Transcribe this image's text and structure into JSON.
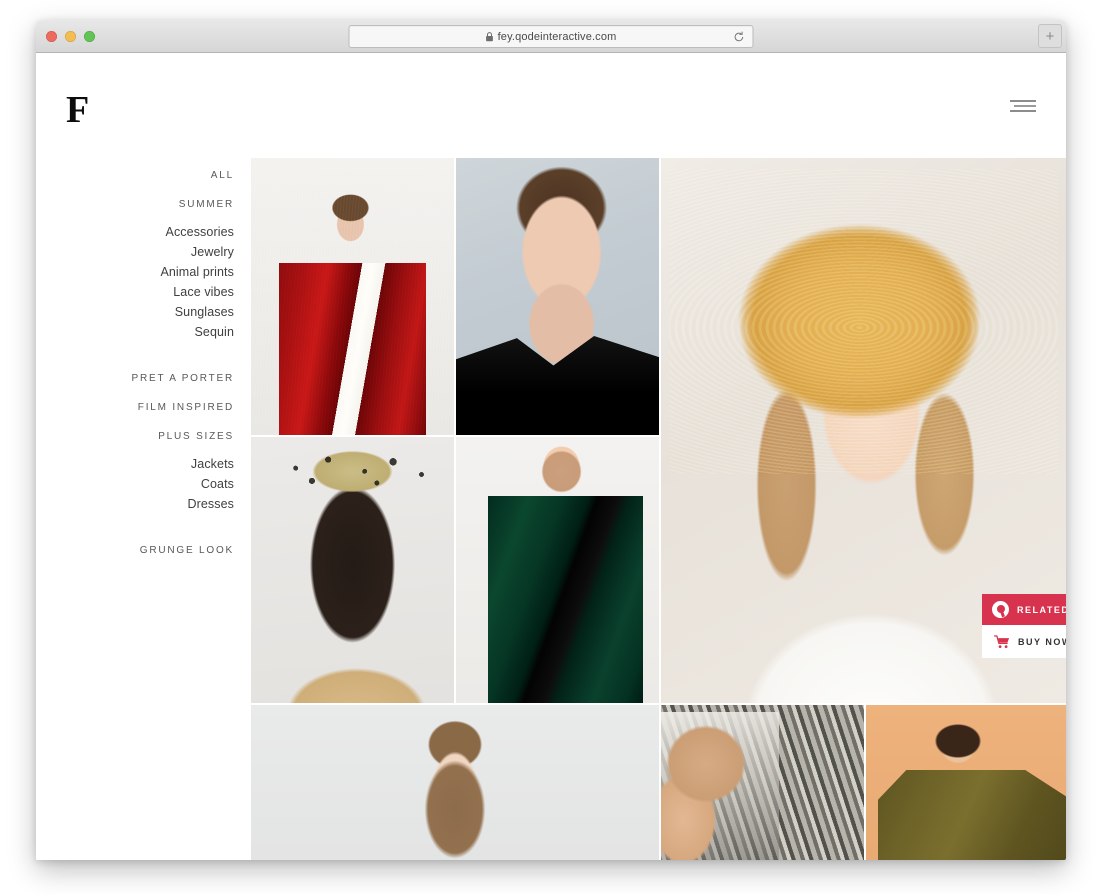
{
  "browser": {
    "url": "fey.qodeinteractive.com",
    "lock_icon": "lock-icon",
    "reload_icon": "reload-icon",
    "new_tab_label": "+",
    "traffic_lights": [
      {
        "name": "close",
        "color": "#ee6a5f"
      },
      {
        "name": "minimize",
        "color": "#f5bd4f"
      },
      {
        "name": "zoom",
        "color": "#61c454"
      }
    ]
  },
  "site": {
    "logo": "F",
    "menu_icon": "hamburger-menu-icon"
  },
  "sidebar": {
    "items": [
      {
        "label": "ALL",
        "type": "cat",
        "active": true
      },
      {
        "label": "SUMMER",
        "type": "cat"
      },
      {
        "label": "Accessories",
        "type": "sub"
      },
      {
        "label": "Jewelry",
        "type": "sub"
      },
      {
        "label": "Animal prints",
        "type": "sub"
      },
      {
        "label": "Lace vibes",
        "type": "sub"
      },
      {
        "label": "Sunglases",
        "type": "sub"
      },
      {
        "label": "Sequin",
        "type": "sub"
      },
      {
        "label": "PRET A PORTER",
        "type": "cat"
      },
      {
        "label": "FILM INSPIRED",
        "type": "cat"
      },
      {
        "label": "PLUS SIZES",
        "type": "cat"
      },
      {
        "label": "Jackets",
        "type": "sub"
      },
      {
        "label": "Coats",
        "type": "sub"
      },
      {
        "label": "Dresses",
        "type": "sub"
      },
      {
        "label": "GRUNGE LOOK",
        "type": "cat"
      }
    ]
  },
  "gallery": {
    "tiles": [
      {
        "name": "tile-red-sequin-jacket",
        "alt": "Model in red sequin jacket"
      },
      {
        "name": "tile-black-hoodie",
        "alt": "Male model in black velvet hoodie"
      },
      {
        "name": "tile-straw-hat",
        "alt": "Girl wearing wide straw hat and white blouse"
      },
      {
        "name": "tile-leopard-beret",
        "alt": "Woman in animal print beret and leopard top"
      },
      {
        "name": "tile-green-velvet",
        "alt": "Model in green velvet jacket with shell necklace"
      },
      {
        "name": "tile-braided-hair",
        "alt": "Girl with braided hair on grey background"
      },
      {
        "name": "tile-hand-metal",
        "alt": "Hand resting on arm against metal pins"
      },
      {
        "name": "tile-olive-bomber",
        "alt": "Model in olive bomber jacket on peach background"
      }
    ]
  },
  "hero_actions": {
    "related_label": "RELATED",
    "related_icon": "qode-logo-icon",
    "related_color": "#d7334f",
    "buy_now_label": "BUY NOW",
    "buy_now_icon": "shopping-cart-icon",
    "buy_now_color": "#ffffff"
  }
}
